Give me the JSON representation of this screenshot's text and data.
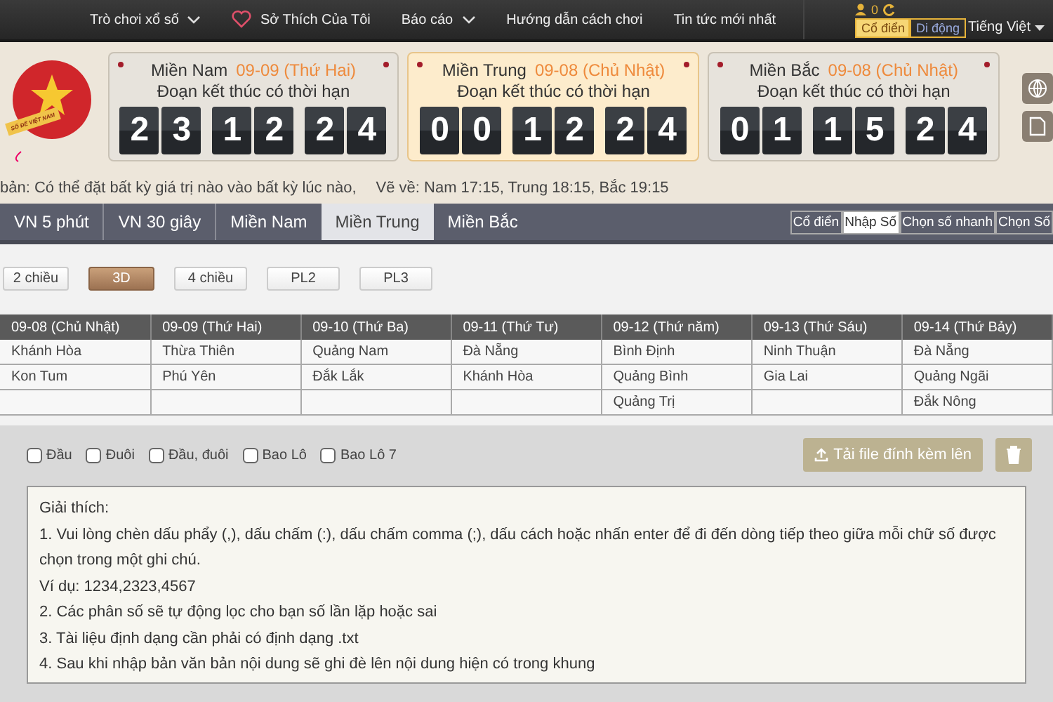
{
  "header": {
    "nav": [
      {
        "label": "Trò chơi xổ số",
        "kind": "menu"
      },
      {
        "label": "Sở Thích Của Tôi",
        "kind": "favorites"
      },
      {
        "label": "Báo cáo",
        "kind": "menu"
      },
      {
        "label": "Hướng dẫn cách chơi",
        "kind": "link"
      },
      {
        "label": "Tin tức mới nhất",
        "kind": "link"
      }
    ],
    "user_count": "0",
    "view_modes": [
      {
        "label": "Cổ điển",
        "selected": true
      },
      {
        "label": "Di động",
        "selected": false
      }
    ],
    "language": "Tiếng Việt"
  },
  "logo": {
    "ribbon": "SỐ ĐỀ VIỆT NAM"
  },
  "countdowns": [
    {
      "region": "Miền Nam",
      "date": "09-09 (Thứ Hai)",
      "caption": "Đoạn kết thúc có thời hạn",
      "digits": [
        "2",
        "3",
        "1",
        "2",
        "2",
        "4"
      ],
      "selected": false
    },
    {
      "region": "Miền Trung",
      "date": "09-08 (Chủ Nhật)",
      "caption": "Đoạn kết thúc có thời hạn",
      "digits": [
        "0",
        "0",
        "1",
        "2",
        "2",
        "4"
      ],
      "selected": true
    },
    {
      "region": "Miền Bắc",
      "date": "09-08 (Chủ Nhật)",
      "caption": "Đoạn kết thúc có thời hạn",
      "digits": [
        "0",
        "1",
        "1",
        "5",
        "2",
        "4"
      ],
      "selected": false
    }
  ],
  "ticker": {
    "notice": "bản: Có thể đặt bất kỳ giá trị nào vào bất kỳ lúc nào,",
    "draw_times": "Vẽ về: Nam 17:15, Trung 18:15, Bắc 19:15"
  },
  "region_tabs": [
    {
      "label": "VN 5 phút",
      "selected": false
    },
    {
      "label": "VN 30 giây",
      "selected": false
    },
    {
      "label": "Miền Nam",
      "selected": false
    },
    {
      "label": "Miền Trung",
      "selected": true
    },
    {
      "label": "Miền Bắc",
      "selected": false
    }
  ],
  "mode_tabs": [
    {
      "label": "Cổ điển",
      "selected": false
    },
    {
      "label": "Nhập Số",
      "selected": true
    },
    {
      "label": "Chọn số nhanh",
      "selected": false
    },
    {
      "label": "Chọn Số",
      "selected": false
    }
  ],
  "bet_types": [
    {
      "label": "2 chiều",
      "selected": false
    },
    {
      "label": "3D",
      "selected": true
    },
    {
      "label": "4 chiều",
      "selected": false
    },
    {
      "label": "PL2",
      "selected": false
    },
    {
      "label": "PL3",
      "selected": false
    }
  ],
  "schedule": {
    "columns": [
      "09-08 (Chủ Nhật)",
      "09-09 (Thứ Hai)",
      "09-10 (Thứ Ba)",
      "09-11 (Thứ Tư)",
      "09-12 (Thứ năm)",
      "09-13 (Thứ Sáu)",
      "09-14 (Thứ Bảy)"
    ],
    "rows": [
      [
        "Khánh Hòa",
        "Thừa Thiên",
        "Quảng Nam",
        "Đà Nẵng",
        "Bình Định",
        "Ninh Thuận",
        "Đà Nẵng"
      ],
      [
        "Kon Tum",
        "Phú Yên",
        "Đắk Lắk",
        "Khánh Hòa",
        "Quảng Bình",
        "Gia Lai",
        "Quảng Ngãi"
      ],
      [
        "",
        "",
        "",
        "",
        "Quảng Trị",
        "",
        "Đắk Nông"
      ]
    ]
  },
  "options": [
    {
      "label": "Đầu",
      "checked": false
    },
    {
      "label": "Đuôi",
      "checked": false
    },
    {
      "label": "Đầu, đuôi",
      "checked": false
    },
    {
      "label": "Bao Lô",
      "checked": false
    },
    {
      "label": "Bao Lô 7",
      "checked": false
    }
  ],
  "upload_button": "Tải file đính kèm lên",
  "instructions": [
    "Giải thích:",
    "1. Vui lòng chèn dấu phẩy (,), dấu chấm (:), dấu chấm comma (;), dấu cách hoặc nhấn enter để đi đến dòng tiếp theo giữa mỗi chữ số được chọn trong một ghi chú.",
    "Ví dụ: 1234,2323,4567",
    "2. Các phân số sẽ tự động lọc cho bạn số lần lặp hoặc sai",
    "3. Tài liệu định dạng cần phải có định dạng .txt",
    "4. Sau khi nhập bản văn bản nội dung sẽ ghi đè lên nội dung hiện có trong khung"
  ]
}
